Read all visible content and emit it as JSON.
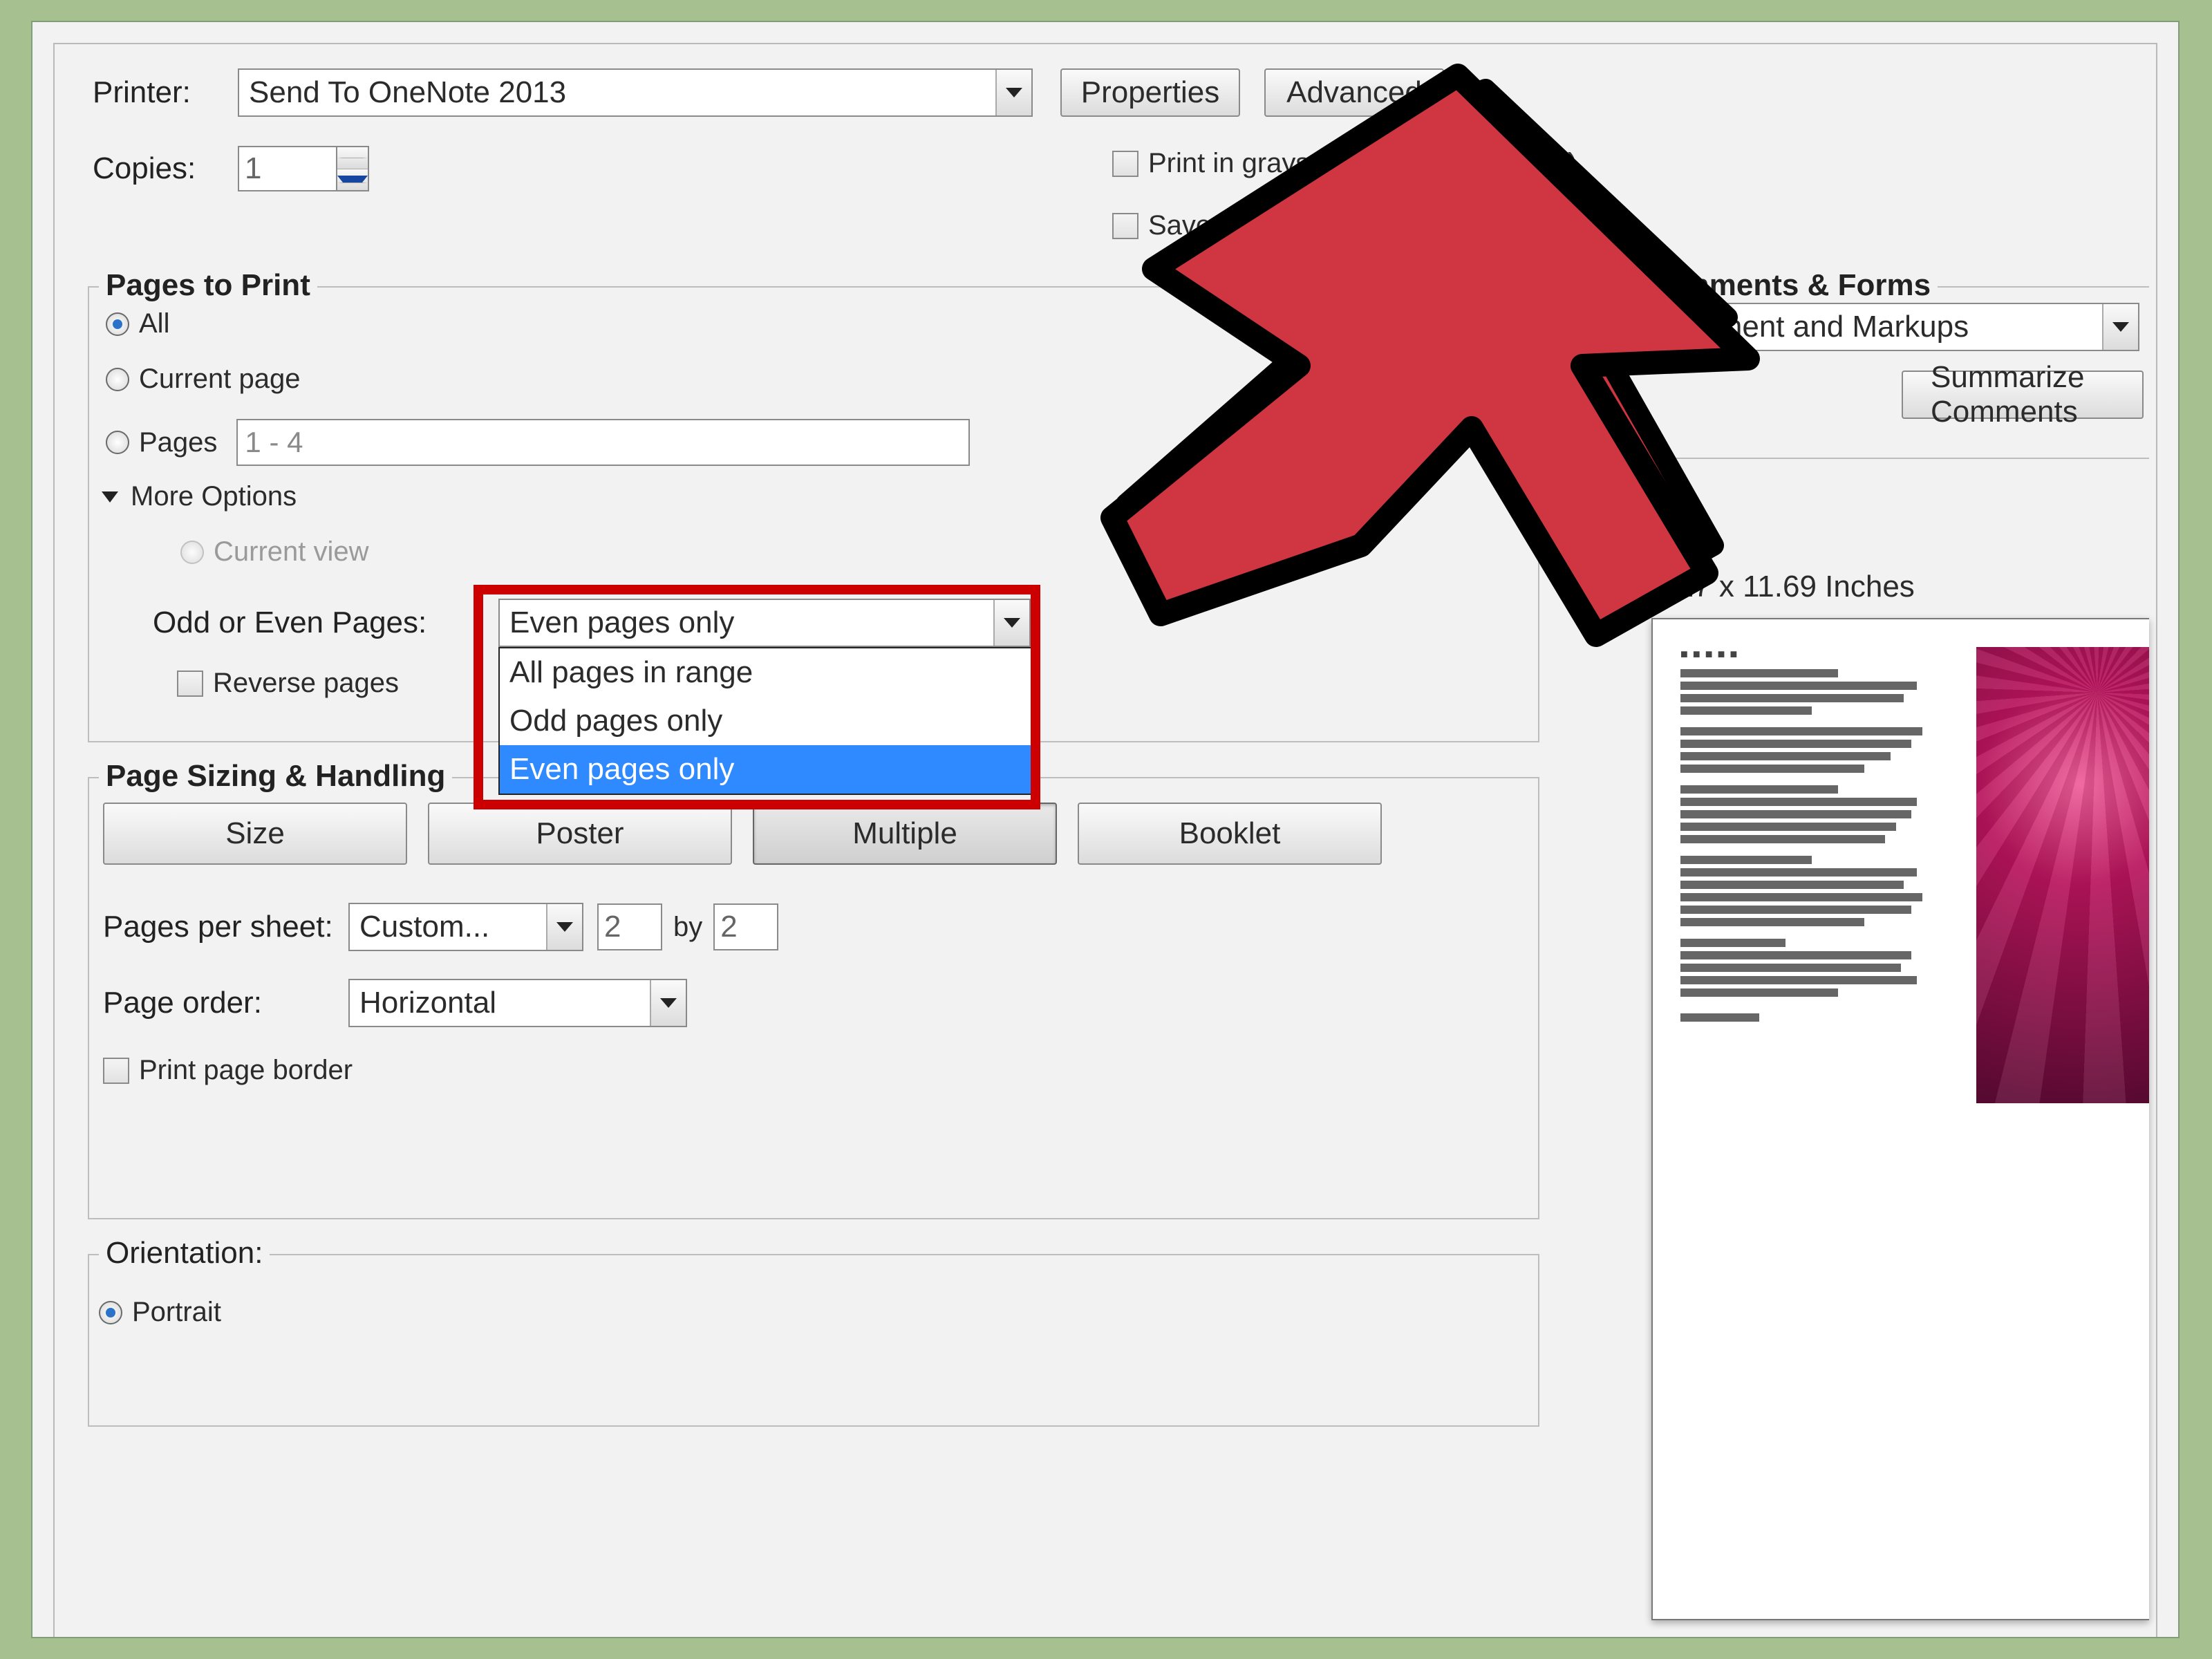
{
  "printer": {
    "label": "Printer:",
    "selected": "Send To OneNote 2013",
    "properties_btn": "Properties",
    "advanced_btn": "Advanced"
  },
  "copies": {
    "label": "Copies:",
    "value": "1"
  },
  "options": {
    "grayscale": "Print in grayscale (black and white)",
    "saveink": "Save ink/toner"
  },
  "pagesToPrint": {
    "legend": "Pages to Print",
    "all": "All",
    "current": "Current page",
    "pages_label": "Pages",
    "pages_value": "1 - 4",
    "more": "More Options",
    "current_view": "Current view",
    "odd_even_label": "Odd or Even Pages:",
    "odd_even_selected": "Even pages only",
    "odd_even_options": [
      "All pages in range",
      "Odd pages only",
      "Even pages only"
    ],
    "reverse": "Reverse pages"
  },
  "sizing": {
    "legend": "Page Sizing & Handling",
    "buttons": {
      "size": "Size",
      "poster": "Poster",
      "multiple": "Multiple",
      "booklet": "Booklet"
    },
    "pps_label": "Pages per sheet:",
    "pps_value": "Custom...",
    "pps_cols": "2",
    "pps_by": "by",
    "pps_rows": "2",
    "order_label": "Page order:",
    "order_value": "Horizontal",
    "border": "Print page border"
  },
  "orientation": {
    "legend": "Orientation:",
    "portrait": "Portrait"
  },
  "commentsForms": {
    "legend": "Comments & Forms",
    "selected": "Document and Markups",
    "summarize_btn": "Summarize Comments"
  },
  "preview": {
    "dimensions": "8.27 x 11.69 Inches"
  }
}
